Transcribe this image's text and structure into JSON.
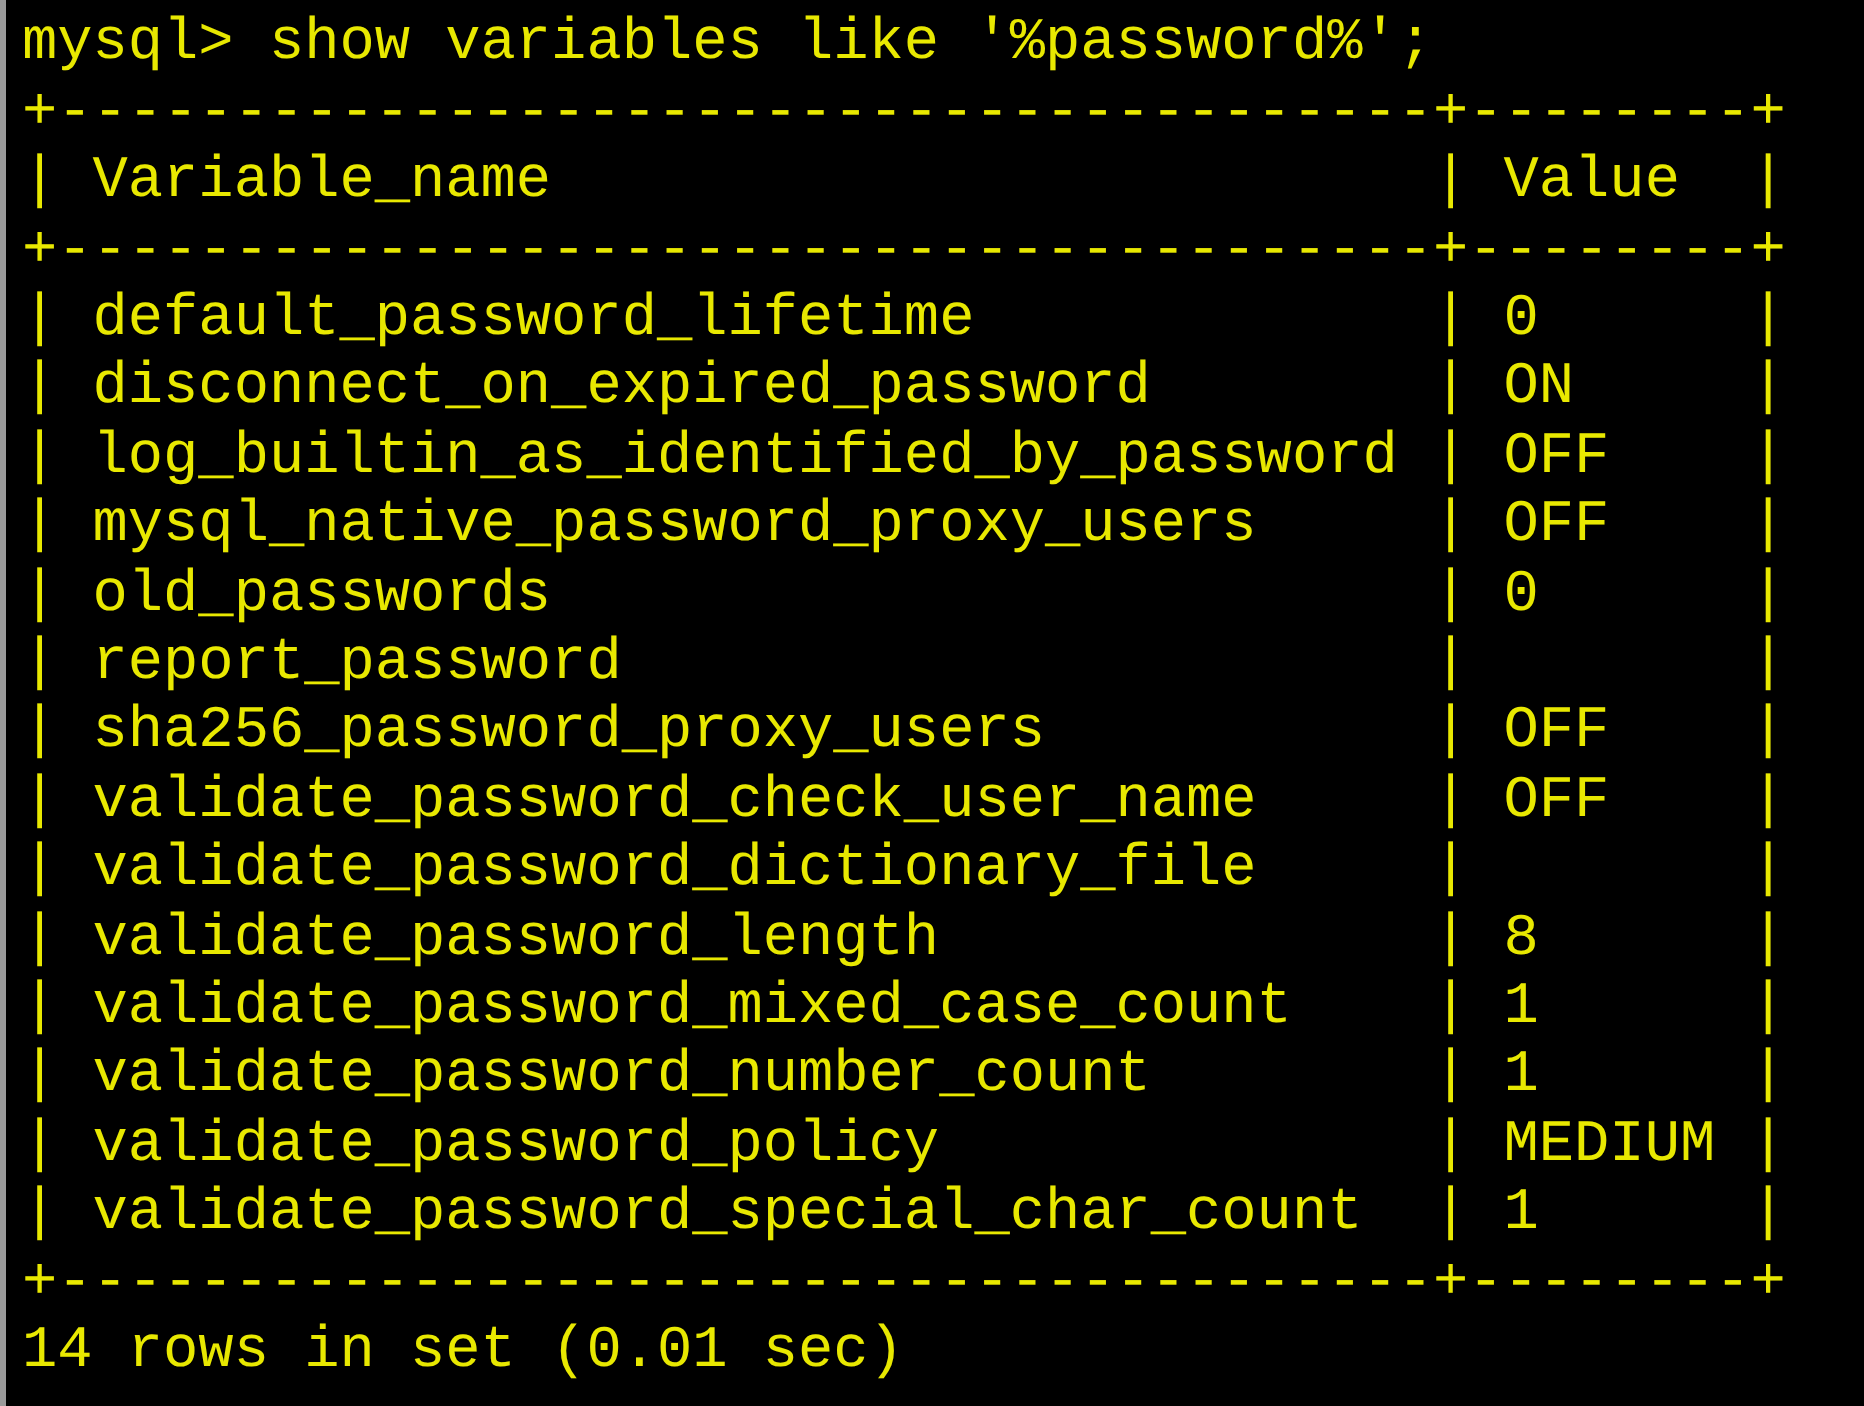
{
  "terminal": {
    "command": "mysql> show variables like '%password%';",
    "table": {
      "top_border": "+---------------------------------------+--------+",
      "header": "| Variable_name                         | Value  |",
      "header_border": "+---------------------------------------+--------+",
      "rows": [
        "| default_password_lifetime             | 0      |",
        "| disconnect_on_expired_password        | ON     |",
        "| log_builtin_as_identified_by_password | OFF    |",
        "| mysql_native_password_proxy_users     | OFF    |",
        "| old_passwords                         | 0      |",
        "| report_password                       |        |",
        "| sha256_password_proxy_users           | OFF    |",
        "| validate_password_check_user_name     | OFF    |",
        "| validate_password_dictionary_file     |        |",
        "| validate_password_length              | 8      |",
        "| validate_password_mixed_case_count    | 1      |",
        "| validate_password_number_count        | 1      |",
        "| validate_password_policy              | MEDIUM |",
        "| validate_password_special_char_count  | 1      |"
      ],
      "bottom_border": "+---------------------------------------+--------+"
    },
    "summary": "14 rows in set (0.01 sec)"
  }
}
